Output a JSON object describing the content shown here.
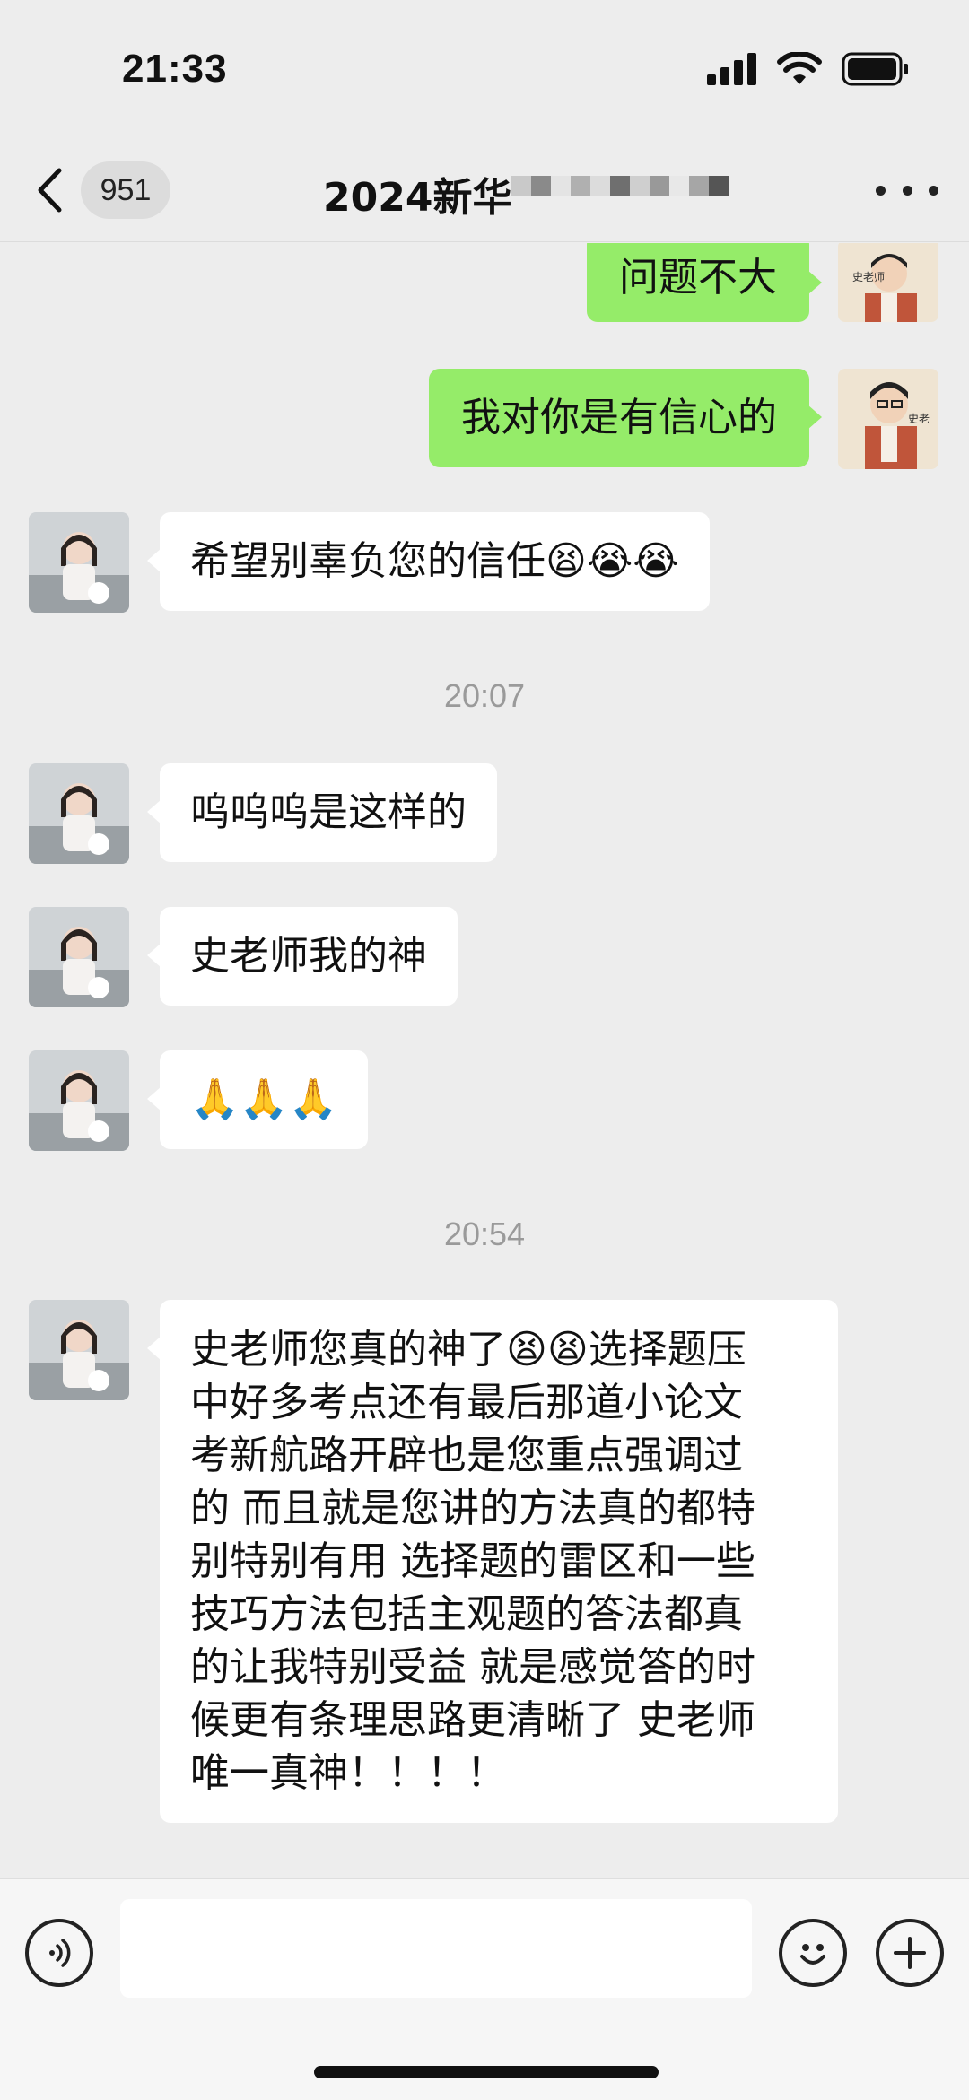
{
  "status_bar": {
    "time": "21:33"
  },
  "nav": {
    "unread_count": "951",
    "title": "2024新华"
  },
  "messages": [
    {
      "side": "right",
      "text": "问题不大"
    },
    {
      "side": "right",
      "text": "我对你是有信心的"
    },
    {
      "side": "left",
      "text": "希望别辜负您的信任😫😭😭"
    },
    {
      "timestamp": "20:07"
    },
    {
      "side": "left",
      "text": "呜呜呜是这样的"
    },
    {
      "side": "left",
      "text": "史老师我的神"
    },
    {
      "side": "left",
      "text": "🙏🙏🙏"
    },
    {
      "timestamp": "20:54"
    },
    {
      "side": "left",
      "text": "史老师您真的神了😫😫选择题压\n中好多考点还有最后那道小论文\n考新航路开辟也是您重点强调过\n的 而且就是您讲的方法真的都特\n别特别有用 选择题的雷区和一些\n技巧方法包括主观题的答法都真\n的让我特别受益 就是感觉答的时\n候更有条理思路更清晰了 史老师\n唯一真神！！！！"
    }
  ],
  "input": {
    "placeholder": ""
  },
  "icons": {
    "back": "chevron-left-icon",
    "more": "more-dots-icon",
    "voice": "voice-icon",
    "emoji": "emoji-icon",
    "plus": "plus-icon"
  },
  "colors": {
    "background": "#ededed",
    "sent_bubble": "#95ec69",
    "received_bubble": "#ffffff"
  }
}
